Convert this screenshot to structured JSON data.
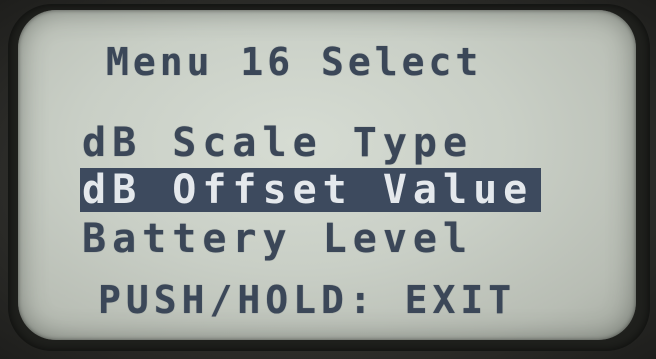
{
  "screen": {
    "title": "Menu 16 Select",
    "menu": {
      "items": [
        {
          "label": "dB Scale Type",
          "selected": false
        },
        {
          "label": "dB Offset Value",
          "selected": true
        },
        {
          "label": "Battery Level",
          "selected": false
        }
      ]
    },
    "footer": "PUSH/HOLD: EXIT"
  },
  "colors": {
    "lcd_background": "#c9cfc6",
    "lcd_text": "#3b4758",
    "highlight_background": "#3d4a5e",
    "highlight_text": "#e4e8ec"
  }
}
